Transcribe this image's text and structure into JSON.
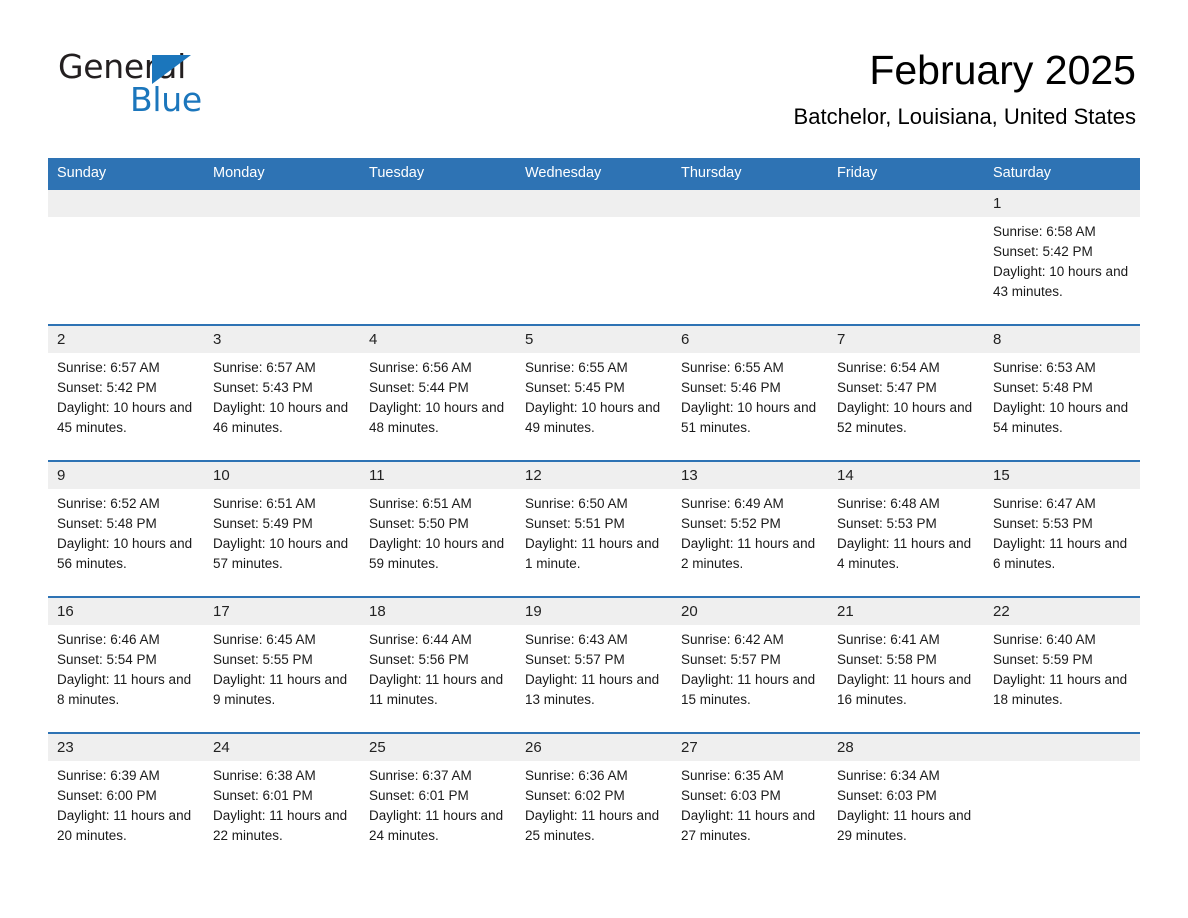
{
  "brand": {
    "name_part1": "General",
    "name_part2": "Blue",
    "accent_color": "#1b76bc"
  },
  "header": {
    "title": "February 2025",
    "location": "Batchelor, Louisiana, United States"
  },
  "theme": {
    "header_blue": "#2e73b4",
    "daynum_gray": "#efefef"
  },
  "calendar": {
    "weekdays": [
      "Sunday",
      "Monday",
      "Tuesday",
      "Wednesday",
      "Thursday",
      "Friday",
      "Saturday"
    ],
    "labels": {
      "sunrise": "Sunrise:",
      "sunset": "Sunset:",
      "daylight": "Daylight:"
    },
    "weeks": [
      [
        {
          "day": ""
        },
        {
          "day": ""
        },
        {
          "day": ""
        },
        {
          "day": ""
        },
        {
          "day": ""
        },
        {
          "day": ""
        },
        {
          "day": "1",
          "sunrise": "Sunrise: 6:58 AM",
          "sunset": "Sunset: 5:42 PM",
          "daylight": "Daylight: 10 hours and 43 minutes."
        }
      ],
      [
        {
          "day": "2",
          "sunrise": "Sunrise: 6:57 AM",
          "sunset": "Sunset: 5:42 PM",
          "daylight": "Daylight: 10 hours and 45 minutes."
        },
        {
          "day": "3",
          "sunrise": "Sunrise: 6:57 AM",
          "sunset": "Sunset: 5:43 PM",
          "daylight": "Daylight: 10 hours and 46 minutes."
        },
        {
          "day": "4",
          "sunrise": "Sunrise: 6:56 AM",
          "sunset": "Sunset: 5:44 PM",
          "daylight": "Daylight: 10 hours and 48 minutes."
        },
        {
          "day": "5",
          "sunrise": "Sunrise: 6:55 AM",
          "sunset": "Sunset: 5:45 PM",
          "daylight": "Daylight: 10 hours and 49 minutes."
        },
        {
          "day": "6",
          "sunrise": "Sunrise: 6:55 AM",
          "sunset": "Sunset: 5:46 PM",
          "daylight": "Daylight: 10 hours and 51 minutes."
        },
        {
          "day": "7",
          "sunrise": "Sunrise: 6:54 AM",
          "sunset": "Sunset: 5:47 PM",
          "daylight": "Daylight: 10 hours and 52 minutes."
        },
        {
          "day": "8",
          "sunrise": "Sunrise: 6:53 AM",
          "sunset": "Sunset: 5:48 PM",
          "daylight": "Daylight: 10 hours and 54 minutes."
        }
      ],
      [
        {
          "day": "9",
          "sunrise": "Sunrise: 6:52 AM",
          "sunset": "Sunset: 5:48 PM",
          "daylight": "Daylight: 10 hours and 56 minutes."
        },
        {
          "day": "10",
          "sunrise": "Sunrise: 6:51 AM",
          "sunset": "Sunset: 5:49 PM",
          "daylight": "Daylight: 10 hours and 57 minutes."
        },
        {
          "day": "11",
          "sunrise": "Sunrise: 6:51 AM",
          "sunset": "Sunset: 5:50 PM",
          "daylight": "Daylight: 10 hours and 59 minutes."
        },
        {
          "day": "12",
          "sunrise": "Sunrise: 6:50 AM",
          "sunset": "Sunset: 5:51 PM",
          "daylight": "Daylight: 11 hours and 1 minute."
        },
        {
          "day": "13",
          "sunrise": "Sunrise: 6:49 AM",
          "sunset": "Sunset: 5:52 PM",
          "daylight": "Daylight: 11 hours and 2 minutes."
        },
        {
          "day": "14",
          "sunrise": "Sunrise: 6:48 AM",
          "sunset": "Sunset: 5:53 PM",
          "daylight": "Daylight: 11 hours and 4 minutes."
        },
        {
          "day": "15",
          "sunrise": "Sunrise: 6:47 AM",
          "sunset": "Sunset: 5:53 PM",
          "daylight": "Daylight: 11 hours and 6 minutes."
        }
      ],
      [
        {
          "day": "16",
          "sunrise": "Sunrise: 6:46 AM",
          "sunset": "Sunset: 5:54 PM",
          "daylight": "Daylight: 11 hours and 8 minutes."
        },
        {
          "day": "17",
          "sunrise": "Sunrise: 6:45 AM",
          "sunset": "Sunset: 5:55 PM",
          "daylight": "Daylight: 11 hours and 9 minutes."
        },
        {
          "day": "18",
          "sunrise": "Sunrise: 6:44 AM",
          "sunset": "Sunset: 5:56 PM",
          "daylight": "Daylight: 11 hours and 11 minutes."
        },
        {
          "day": "19",
          "sunrise": "Sunrise: 6:43 AM",
          "sunset": "Sunset: 5:57 PM",
          "daylight": "Daylight: 11 hours and 13 minutes."
        },
        {
          "day": "20",
          "sunrise": "Sunrise: 6:42 AM",
          "sunset": "Sunset: 5:57 PM",
          "daylight": "Daylight: 11 hours and 15 minutes."
        },
        {
          "day": "21",
          "sunrise": "Sunrise: 6:41 AM",
          "sunset": "Sunset: 5:58 PM",
          "daylight": "Daylight: 11 hours and 16 minutes."
        },
        {
          "day": "22",
          "sunrise": "Sunrise: 6:40 AM",
          "sunset": "Sunset: 5:59 PM",
          "daylight": "Daylight: 11 hours and 18 minutes."
        }
      ],
      [
        {
          "day": "23",
          "sunrise": "Sunrise: 6:39 AM",
          "sunset": "Sunset: 6:00 PM",
          "daylight": "Daylight: 11 hours and 20 minutes."
        },
        {
          "day": "24",
          "sunrise": "Sunrise: 6:38 AM",
          "sunset": "Sunset: 6:01 PM",
          "daylight": "Daylight: 11 hours and 22 minutes."
        },
        {
          "day": "25",
          "sunrise": "Sunrise: 6:37 AM",
          "sunset": "Sunset: 6:01 PM",
          "daylight": "Daylight: 11 hours and 24 minutes."
        },
        {
          "day": "26",
          "sunrise": "Sunrise: 6:36 AM",
          "sunset": "Sunset: 6:02 PM",
          "daylight": "Daylight: 11 hours and 25 minutes."
        },
        {
          "day": "27",
          "sunrise": "Sunrise: 6:35 AM",
          "sunset": "Sunset: 6:03 PM",
          "daylight": "Daylight: 11 hours and 27 minutes."
        },
        {
          "day": "28",
          "sunrise": "Sunrise: 6:34 AM",
          "sunset": "Sunset: 6:03 PM",
          "daylight": "Daylight: 11 hours and 29 minutes."
        },
        {
          "day": ""
        }
      ]
    ]
  }
}
